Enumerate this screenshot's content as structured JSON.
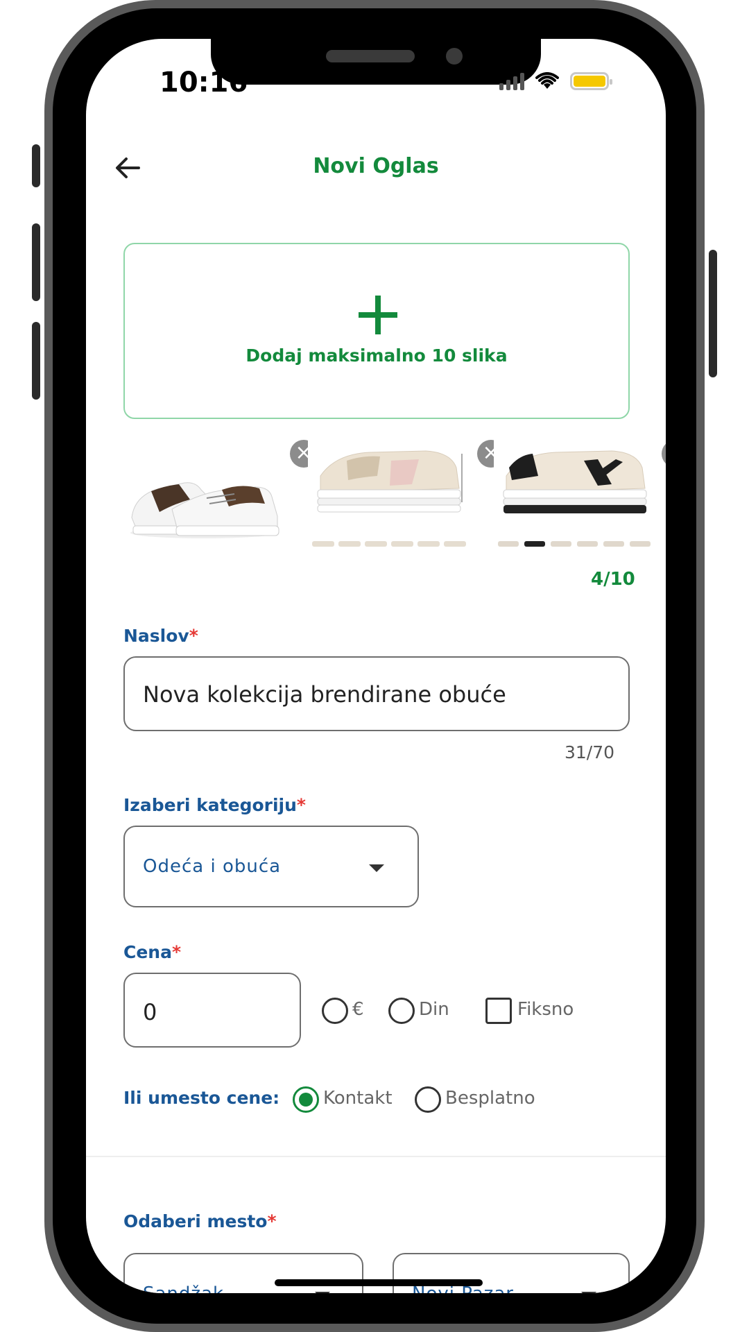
{
  "status_bar": {
    "time": "10:16"
  },
  "header": {
    "title": "Novi Oglas"
  },
  "upload": {
    "label": "Dodaj maksimalno 10 slika",
    "counter": "4/10"
  },
  "images": [
    {
      "name": "sneaker-photo-1"
    },
    {
      "name": "sneaker-photo-2"
    },
    {
      "name": "sneaker-photo-3"
    }
  ],
  "title_field": {
    "label": "Naslov",
    "required_mark": "*",
    "value": "Nova kolekcija brendirane obuće",
    "counter": "31/70"
  },
  "category_field": {
    "label": "Izaberi kategoriju",
    "required_mark": "*",
    "selected": "Odeća i obuća"
  },
  "price_field": {
    "label": "Cena",
    "required_mark": "*",
    "value": "0",
    "currency_options": [
      "€",
      "Din"
    ],
    "fixed_label": "Fiksno"
  },
  "alt_price": {
    "label": "Ili umesto cene:",
    "options": [
      {
        "label": "Kontakt",
        "selected": true
      },
      {
        "label": "Besplatno",
        "selected": false
      }
    ]
  },
  "place_field": {
    "label": "Odaberi mesto",
    "required_mark": "*",
    "region": "Sandžak",
    "city": "Novi Pazar"
  },
  "colors": {
    "accent_green": "#138a3c",
    "label_blue": "#1a5796",
    "required_red": "#e53935",
    "upload_border": "#8fd6a8"
  }
}
